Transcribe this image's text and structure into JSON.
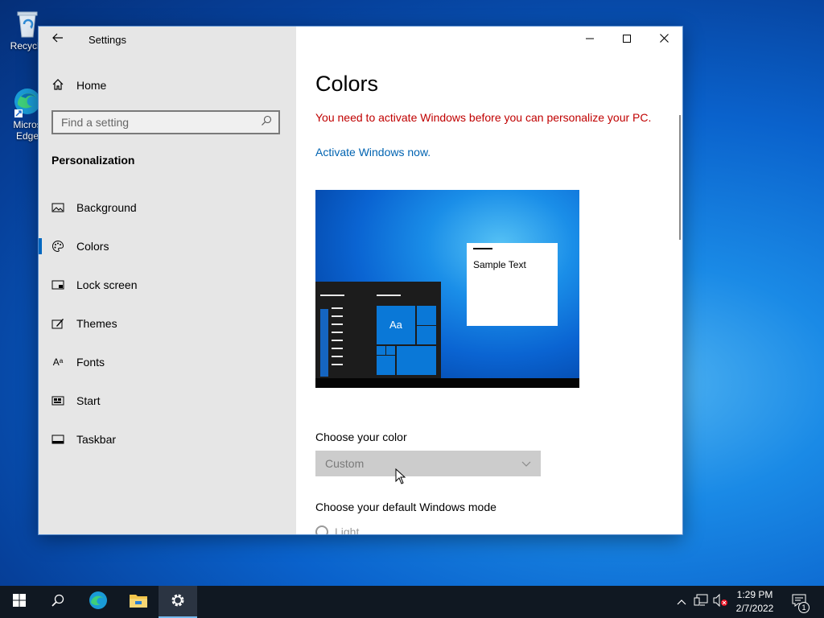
{
  "desktop": {
    "icons": [
      {
        "label": "Recycle",
        "icon": "recycle-bin-icon"
      },
      {
        "label_line1": "Micros",
        "label_line2": "Edge",
        "icon": "edge-icon"
      }
    ]
  },
  "window": {
    "title": "Settings",
    "nav": {
      "home_label": "Home",
      "search_placeholder": "Find a setting",
      "section_title": "Personalization",
      "items": [
        {
          "label": "Background",
          "icon": "picture-icon"
        },
        {
          "label": "Colors",
          "icon": "palette-icon",
          "active": true
        },
        {
          "label": "Lock screen",
          "icon": "lock-screen-icon"
        },
        {
          "label": "Themes",
          "icon": "brush-icon"
        },
        {
          "label": "Fonts",
          "icon": "font-icon"
        },
        {
          "label": "Start",
          "icon": "start-icon"
        },
        {
          "label": "Taskbar",
          "icon": "taskbar-icon"
        }
      ]
    },
    "content": {
      "heading": "Colors",
      "warning": "You need to activate Windows before you can personalize your PC.",
      "activate_link": "Activate Windows now.",
      "preview": {
        "sample_text": "Sample Text",
        "tile_text": "Aa"
      },
      "choose_color_label": "Choose your color",
      "choose_color_value": "Custom",
      "mode_label": "Choose your default Windows mode",
      "mode_option": "Light"
    }
  },
  "taskbar": {
    "time": "1:29 PM",
    "date": "2/7/2022",
    "notification_count": "1"
  },
  "colors": {
    "accent": "#0067c0",
    "warning": "#c00000",
    "link": "#0063b1",
    "taskbar": "#101822"
  }
}
